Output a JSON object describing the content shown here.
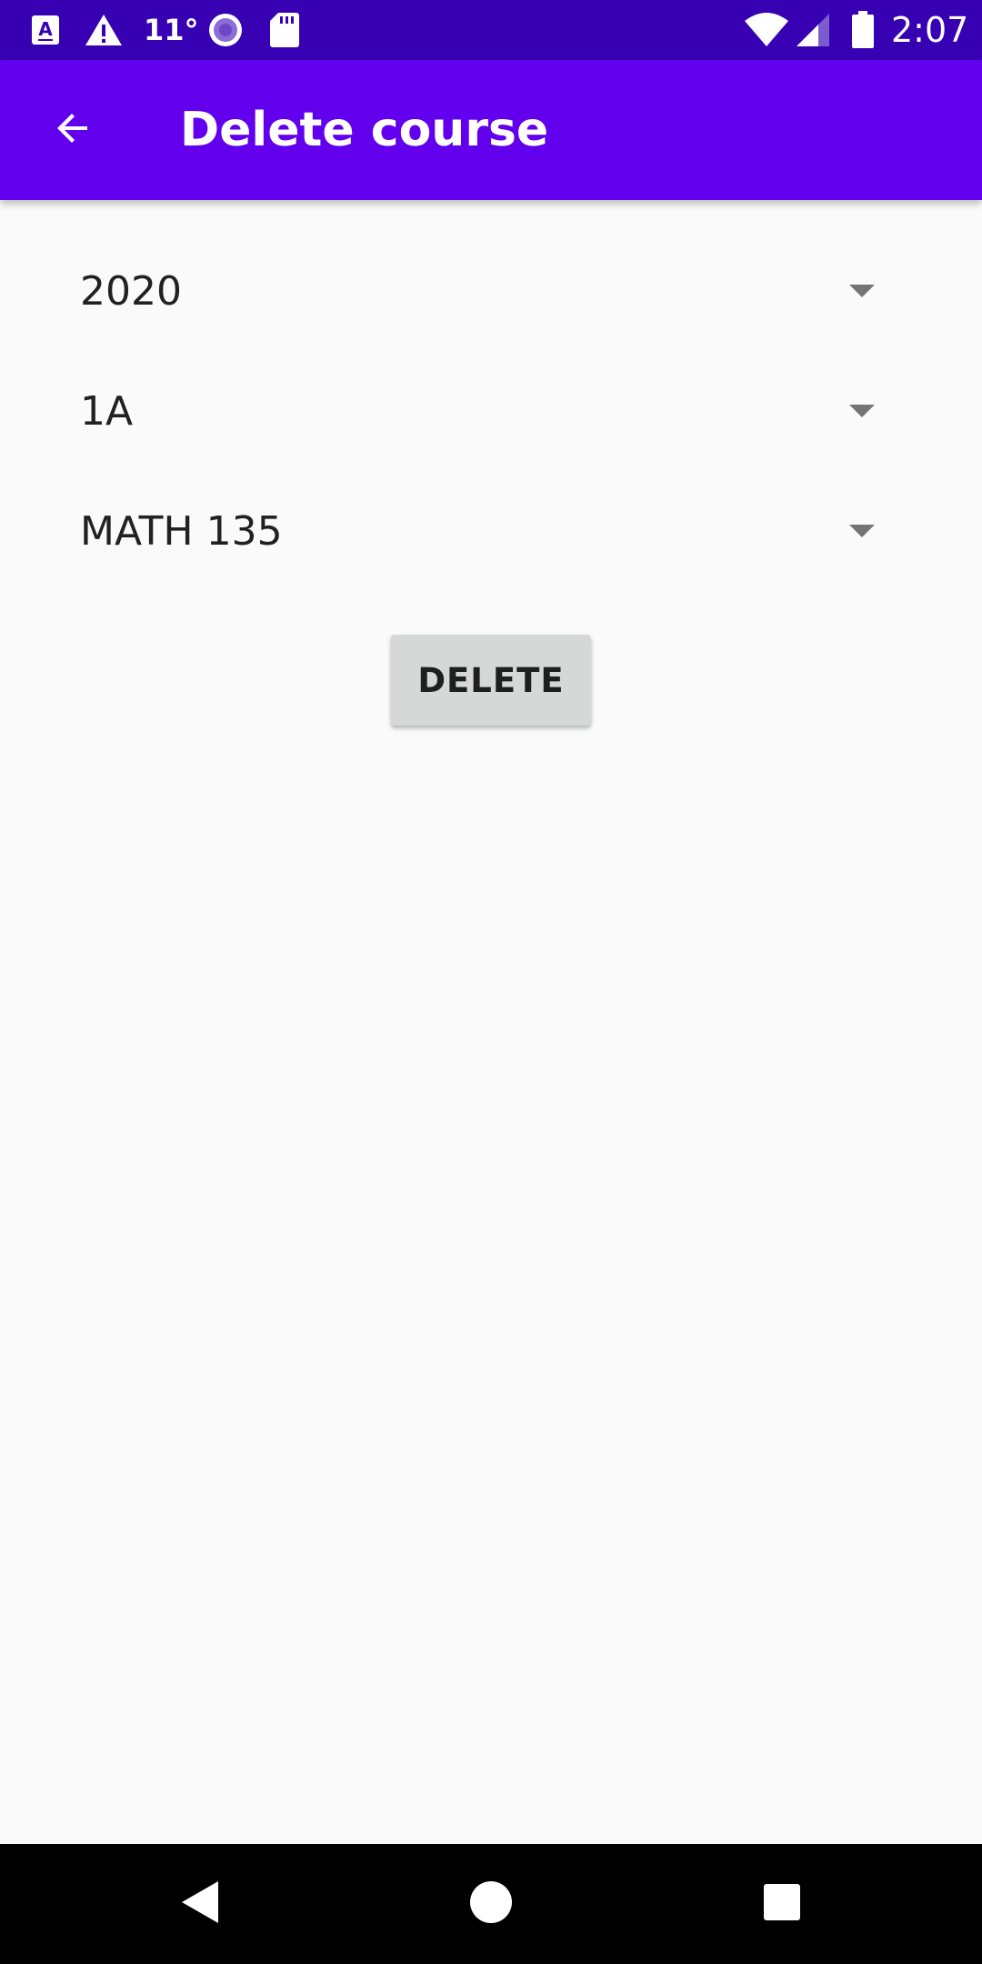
{
  "status_bar": {
    "icons": [
      "accessibility-a-icon",
      "warning-icon",
      "record-icon",
      "sd-card-icon",
      "wifi-icon",
      "cell-signal-icon",
      "battery-icon"
    ],
    "temperature": "11°",
    "time": "2:07",
    "background_color": "#3700b3"
  },
  "app_bar": {
    "title": "Delete course",
    "back_icon": "arrow-back-icon",
    "background_color": "#6200ee"
  },
  "form": {
    "year_spinner": {
      "selected": "2020"
    },
    "term_spinner": {
      "selected": "1A"
    },
    "course_spinner": {
      "selected": "MATH 135"
    },
    "delete_button_label": "DELETE"
  },
  "nav_bar": {
    "icons": [
      "back-triangle-icon",
      "home-circle-icon",
      "recents-square-icon"
    ]
  }
}
